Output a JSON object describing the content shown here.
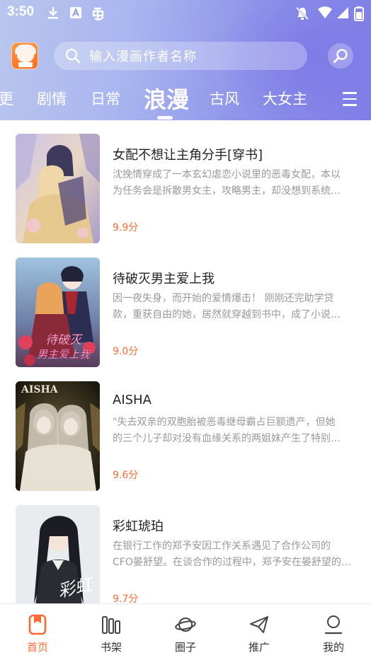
{
  "status_bar": {
    "time": "3:50",
    "icons": [
      "download-icon",
      "a-icon",
      "bug-icon",
      "do-not-disturb-icon",
      "wifi-icon",
      "signal-icon",
      "battery-icon"
    ]
  },
  "header": {
    "search_placeholder": "输入漫画作者名称",
    "accent_gradient": [
      "#b9c6ee",
      "#7f7ee6"
    ]
  },
  "tabs": [
    {
      "label": "更",
      "active": false
    },
    {
      "label": "剧情",
      "active": false
    },
    {
      "label": "日常",
      "active": false
    },
    {
      "label": "浪漫",
      "active": true
    },
    {
      "label": "古风",
      "active": false
    },
    {
      "label": "大女主",
      "active": false
    }
  ],
  "comics": [
    {
      "title": "女配不想让主角分手[穿书]",
      "desc_line1": "沈挽情穿成了一本玄幻虐恋小说里的恶毒女配，本以",
      "desc_line2": "为任务会是拆散男女主，攻略男主，却没想到系统…",
      "score": "9.9分"
    },
    {
      "title": "待破灭男主爱上我",
      "desc_line1": "因一夜失身，而开始的爱情爆击！ 刚刚还完助学贷",
      "desc_line2": "款，重获自由的她，居然就穿越到书中，成了小说…",
      "score": "9.0分"
    },
    {
      "title": "AISHA",
      "desc_line1": "\"失去双亲的双胞胎被恶毒继母霸占巨额遗产，但她",
      "desc_line2": "的三个儿子却对没有血缘关系的两姐妹产生了特别…",
      "score": "9.6分"
    },
    {
      "title": "彩虹琥珀",
      "desc_line1": "在银行工作的郑予安因工作关系遇见了合作公司的",
      "desc_line2": "CFO晏舒望。在谈合作的过程中，郑予安在晏舒望的…",
      "score": "9.7分"
    }
  ],
  "cover_text": {
    "aisha": "AISHA",
    "comic2_line1": "待破灭",
    "comic2_line2": "男主爱上我",
    "comic4": "彩虹"
  },
  "bottom_nav": [
    {
      "label": "首页",
      "icon": "bookmark-icon",
      "active": true
    },
    {
      "label": "书架",
      "icon": "bookshelf-icon",
      "active": false
    },
    {
      "label": "圈子",
      "icon": "planet-icon",
      "active": false
    },
    {
      "label": "推广",
      "icon": "paper-plane-icon",
      "active": false
    },
    {
      "label": "我的",
      "icon": "user-icon",
      "active": false
    }
  ],
  "colors": {
    "accent": "#ff6a33",
    "score": "#ff6a33",
    "desc": "#999999"
  }
}
